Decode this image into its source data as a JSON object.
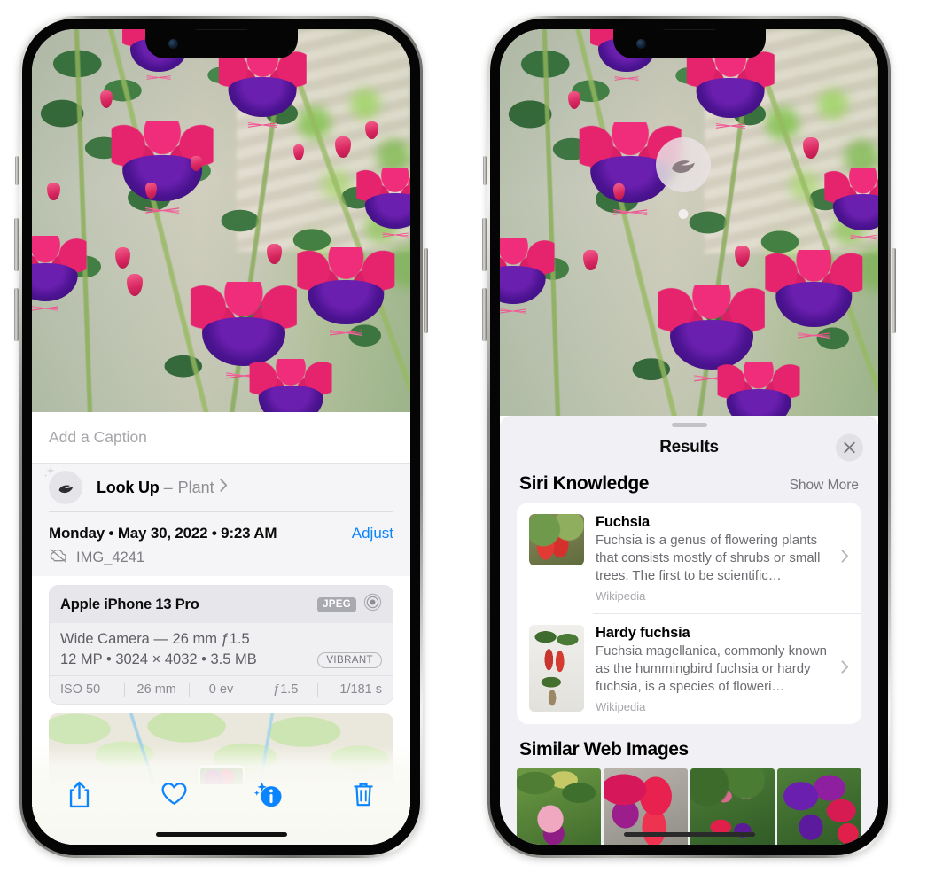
{
  "screenshot": {
    "description": "Two iPhone 13 Pro screenshots side by side showing the Photos app Visual Look Up feature"
  },
  "left_phone": {
    "name": "iphone-photo-info",
    "photo": {
      "alt": "Fuchsia flowers hanging basket"
    },
    "caption": {
      "placeholder": "Add a Caption",
      "value": ""
    },
    "look_up": {
      "icon": "leaf-icon",
      "sparkle_icon": "sparkle-icon",
      "title": "Look Up",
      "dash": "–",
      "subject": "Plant",
      "chevron": "chevron-right-icon"
    },
    "meta": {
      "date": "Monday • May 30, 2022 • 9:23 AM",
      "adjust_label": "Adjust",
      "cloud_icon": "cloud-slash-icon",
      "filename": "IMG_4241"
    },
    "camera_card": {
      "model": "Apple iPhone 13 Pro",
      "format_badge": "JPEG",
      "raw_icon": "camera-aperture-icon",
      "lens_line": "Wide Camera — 26 mm ƒ1.5",
      "specs_line": "12 MP • 3024 × 4032 • 3.5 MB",
      "style_badge": "VIBRANT",
      "exif": [
        "ISO 50",
        "26 mm",
        "0 ev",
        "ƒ1.5",
        "1/181 s"
      ]
    },
    "map": {
      "alt": "Map showing photo location",
      "pin": "photo-thumbnail-pin"
    },
    "toolbar": [
      {
        "name": "share-button",
        "icon": "share-icon"
      },
      {
        "name": "favorite-button",
        "icon": "heart-icon"
      },
      {
        "name": "info-button",
        "icon": "info-sparkle-icon"
      },
      {
        "name": "delete-button",
        "icon": "trash-icon"
      }
    ]
  },
  "right_phone": {
    "name": "iphone-visual-lookup-results",
    "photo_badge": {
      "icon": "leaf-icon",
      "name": "visual-lookup-leaf-badge"
    },
    "sheet": {
      "grabber": "sheet-grabber",
      "title": "Results",
      "close_icon": "close-icon"
    },
    "siri_knowledge": {
      "heading": "Siri Knowledge",
      "show_more": "Show More",
      "items": [
        {
          "title": "Fuchsia",
          "description": "Fuchsia is a genus of flowering plants that consists mostly of shrubs or small trees. The first to be scientific…",
          "source": "Wikipedia",
          "thumb": "fuchsia-red-flowers-thumbnail",
          "chevron": "chevron-right-icon"
        },
        {
          "title": "Hardy fuchsia",
          "description": "Fuchsia magellanica, commonly known as the hummingbird fuchsia or hardy fuchsia, is a species of floweri…",
          "source": "Wikipedia",
          "thumb": "hardy-fuchsia-specimen-thumbnail",
          "chevron": "chevron-right-icon"
        }
      ]
    },
    "similar_web_images": {
      "heading": "Similar Web Images",
      "tiles": [
        "pink-white-fuchsia-thumbnail",
        "red-fuchsia-closeup-thumbnail",
        "fuchsia-bush-thumbnail",
        "purple-fuchsia-cluster-thumbnail"
      ]
    }
  },
  "colors": {
    "accent_blue": "#0a84ff",
    "sheet_background": "#f1f1f5",
    "card_background": "#ffffff",
    "secondary_text": "#8e8e93"
  }
}
